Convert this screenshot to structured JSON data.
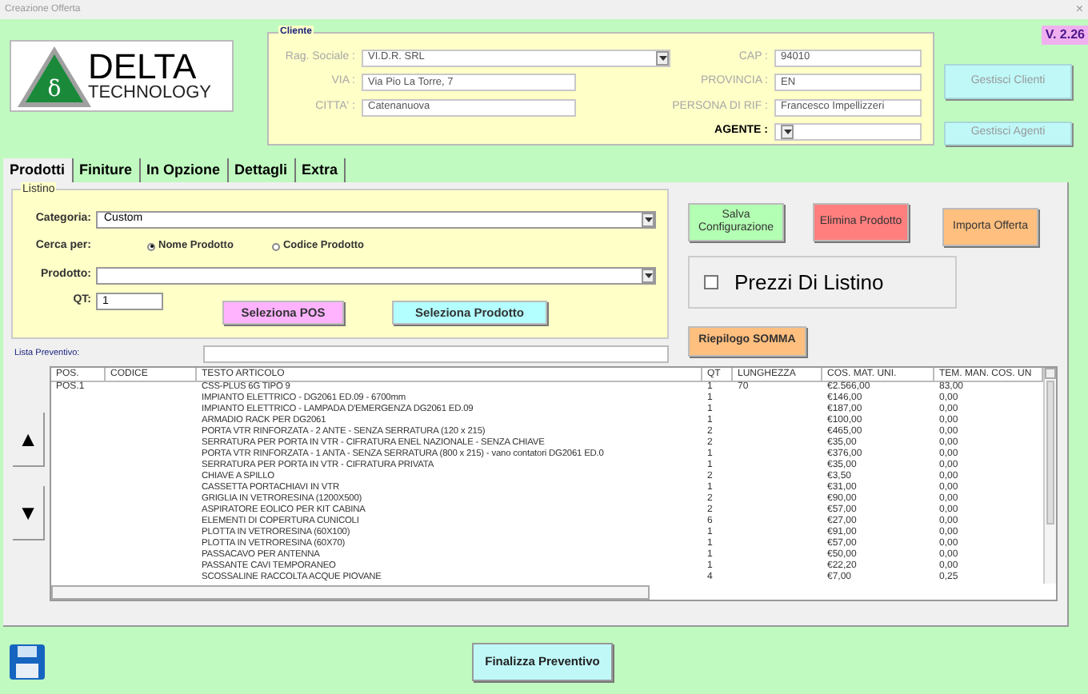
{
  "window": {
    "title": "Creazione Offerta",
    "close": "×"
  },
  "logo": {
    "symbol": "δ",
    "name": "DELTA",
    "subtitle": "TECHNOLOGY"
  },
  "version": "V. 2.26",
  "cliente": {
    "title": "Cliente",
    "fields": [
      {
        "label": "Rag. Sociale :",
        "value": "VI.D.R. SRL",
        "kind": "combo",
        "disabled": true
      },
      {
        "label": "CAP :",
        "value": "94010",
        "kind": "text",
        "disabled": true
      },
      {
        "label": "VIA :",
        "value": "Via Pio La Torre, 7",
        "kind": "text",
        "disabled": true
      },
      {
        "label": "PROVINCIA :",
        "value": "EN",
        "kind": "text",
        "disabled": true
      },
      {
        "label": "CITTA' :",
        "value": "Catenanuova",
        "kind": "text",
        "disabled": true
      },
      {
        "label": "PERSONA DI RIF :",
        "value": "Francesco Impellizzeri",
        "kind": "text",
        "disabled": true
      },
      {
        "label": "AGENTE :",
        "kind": "combo",
        "disabled": false
      }
    ]
  },
  "side_buttons": [
    {
      "label": "Gestisci Clienti",
      "disabled": true
    },
    {
      "label": "Gestisci Agenti",
      "disabled": true
    }
  ],
  "tabs": [
    {
      "label": "Prodotti",
      "selected": true
    },
    {
      "label": "Finiture",
      "selected": false
    },
    {
      "label": "In Opzione",
      "selected": false
    },
    {
      "label": "Dettagli",
      "selected": false
    },
    {
      "label": "Extra",
      "selected": false
    }
  ],
  "listino": {
    "title": "Listino",
    "categoria": {
      "label": "Categoria:",
      "value": "Custom"
    },
    "cerca_per": {
      "label": "Cerca per:",
      "options": [
        {
          "label": "Nome Prodotto",
          "selected": true
        },
        {
          "label": "Codice Prodotto",
          "selected": false
        }
      ]
    },
    "prodotto": {
      "label": "Prodotto:"
    },
    "qt": {
      "label": "QT:",
      "value": "1"
    },
    "buttons": [
      {
        "label": "Seleziona POS",
        "color": "#ffb3ff"
      },
      {
        "label": "Seleziona Prodotto",
        "color": "#b3ffff"
      }
    ]
  },
  "actions": [
    {
      "label": "Salva Configurazione",
      "color": "#b3ffb3"
    },
    {
      "label": "Elimina Prodotto",
      "color": "#ff7f7f"
    },
    {
      "label": "Importa Offerta",
      "color": "#ffbf7f"
    }
  ],
  "prezzi_di_listino": {
    "label": "Prezzi Di Listino",
    "checked": false
  },
  "riepilogo": {
    "label": "Riepilogo SOMMA",
    "color": "#ffbf7f"
  },
  "lista_preventivo": {
    "label": "Lista Preventivo:"
  },
  "arrows": [
    "▲",
    "▼"
  ],
  "table": {
    "columns": [
      "POS.",
      "CODICE",
      "TESTO ARTICOLO",
      "QT",
      "LUNGHEZZA",
      "COS. MAT. UNI.",
      "TEM. MAN. COS. UN"
    ],
    "rows": [
      [
        "POS.1",
        "",
        "CSS-PLUS 6G TIPO 9",
        "1",
        "70",
        "€2.566,00",
        "83,00"
      ],
      [
        "",
        "",
        "IMPIANTO ELETTRICO - DG2061 ED.09 - 6700mm",
        "1",
        "",
        "€146,00",
        "0,00"
      ],
      [
        "",
        "",
        "IMPIANTO ELETTRICO - LAMPADA D'EMERGENZA DG2061 ED.09",
        "1",
        "",
        "€187,00",
        "0,00"
      ],
      [
        "",
        "",
        "ARMADIO RACK PER DG2061",
        "1",
        "",
        "€100,00",
        "0,00"
      ],
      [
        "",
        "",
        "PORTA VTR RINFORZATA - 2 ANTE - SENZA SERRATURA (120 x 215)",
        "2",
        "",
        "€465,00",
        "0,00"
      ],
      [
        "",
        "",
        "SERRATURA PER PORTA IN VTR - CIFRATURA ENEL NAZIONALE - SENZA CHIAVE",
        "2",
        "",
        "€35,00",
        "0,00"
      ],
      [
        "",
        "",
        "PORTA VTR RINFORZATA - 1 ANTA - SENZA SERRATURA (800 x 215) - vano contatori DG2061 ED.0",
        "1",
        "",
        "€376,00",
        "0,00"
      ],
      [
        "",
        "",
        "SERRATURA PER PORTA IN VTR - CIFRATURA PRIVATA",
        "1",
        "",
        "€35,00",
        "0,00"
      ],
      [
        "",
        "",
        "CHIAVE A SPILLO",
        "2",
        "",
        "€3,50",
        "0,00"
      ],
      [
        "",
        "",
        "CASSETTA PORTACHIAVI IN VTR",
        "1",
        "",
        "€31,00",
        "0,00"
      ],
      [
        "",
        "",
        "GRIGLIA IN VETRORESINA (1200X500)",
        "2",
        "",
        "€90,00",
        "0,00"
      ],
      [
        "",
        "",
        "ASPIRATORE EOLICO PER KIT CABINA",
        "2",
        "",
        "€57,00",
        "0,00"
      ],
      [
        "",
        "",
        "ELEMENTI DI COPERTURA CUNICOLI",
        "6",
        "",
        "€27,00",
        "0,00"
      ],
      [
        "",
        "",
        "PLOTTA IN VETRORESINA (60X100)",
        "1",
        "",
        "€91,00",
        "0,00"
      ],
      [
        "",
        "",
        "PLOTTA IN VETRORESINA (60X70)",
        "1",
        "",
        "€57,00",
        "0,00"
      ],
      [
        "",
        "",
        "PASSACAVO PER ANTENNA",
        "1",
        "",
        "€50,00",
        "0,00"
      ],
      [
        "",
        "",
        "PASSANTE CAVI TEMPORANEO",
        "1",
        "",
        "€22,20",
        "0,00"
      ],
      [
        "",
        "",
        "SCOSSALINE RACCOLTA ACQUE PIOVANE",
        "4",
        "",
        "€7,00",
        "0,25"
      ]
    ]
  },
  "finalizza": {
    "label": "Finalizza Preventivo"
  }
}
